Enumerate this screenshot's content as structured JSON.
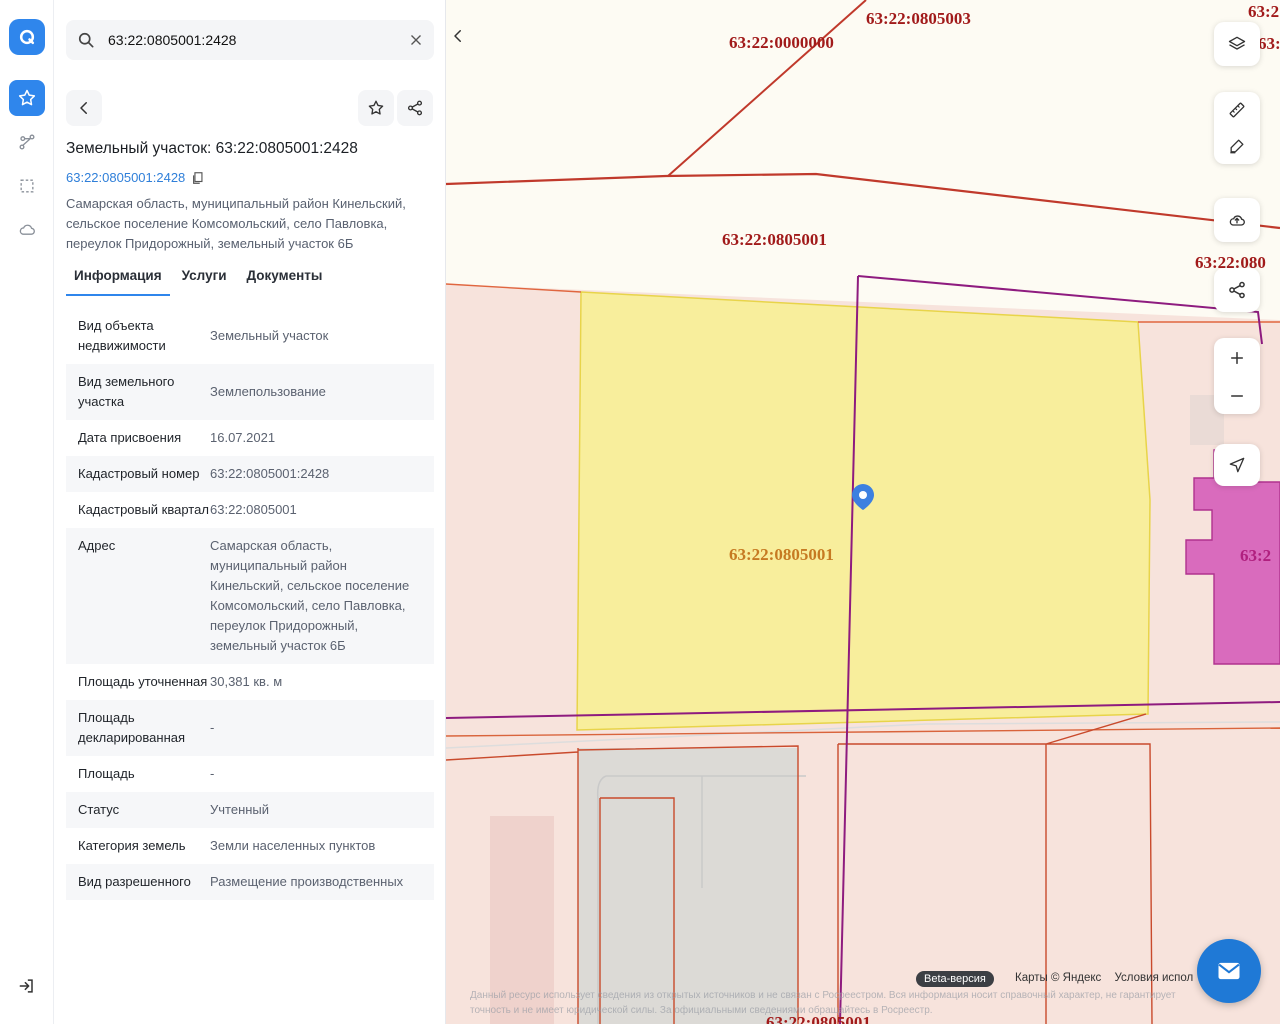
{
  "search": {
    "value": "63:22:0805001:2428"
  },
  "object": {
    "title": "Земельный участок: 63:22:0805001:2428",
    "cadastral_link": "63:22:0805001:2428",
    "address": "Самарская область, муниципальный район Кинельский, сельское поселение Комсомольский, село Павловка, переулок Придорожный, земельный участок 6Б"
  },
  "tabs": [
    {
      "label": "Информация",
      "active": true
    },
    {
      "label": "Услуги"
    },
    {
      "label": "Документы"
    }
  ],
  "properties": [
    {
      "key": "Вид объекта недвижимости",
      "value": "Земельный участок"
    },
    {
      "key": "Вид земельного участка",
      "value": "Землепользование"
    },
    {
      "key": "Дата присвоения",
      "value": "16.07.2021"
    },
    {
      "key": "Кадастровый номер",
      "value": "63:22:0805001:2428"
    },
    {
      "key": "Кадастровый квартал",
      "value": "63:22:0805001"
    },
    {
      "key": "Адрес",
      "value": "Самарская область, муниципальный район Кинельский, сельское поселение Комсомольский, село Павловка, переулок Придорожный, земельный участок 6Б"
    },
    {
      "key": "Площадь уточненная",
      "value": "30,381 кв. м"
    },
    {
      "key": "Площадь декларированная",
      "value": "-"
    },
    {
      "key": "Площадь",
      "value": "-"
    },
    {
      "key": "Статус",
      "value": "Учтенный"
    },
    {
      "key": "Категория земель",
      "value": "Земли населенных пунктов"
    },
    {
      "key": "Вид разрешенного",
      "value": "Размещение производственных"
    }
  ],
  "map": {
    "labels": {
      "q_0000000": "63:22:0000000",
      "q_0805003": "63:22:0805003",
      "q_0805001_top": "63:22:0805001",
      "q_0805001_parcel": "63:22:0805001",
      "q_right_top": "63:2",
      "q_right_top2": "63:2",
      "q_right_mid": "63:22:080",
      "q_right_pink": "63:2",
      "q_bottom": "63:22:0805001"
    },
    "beta": "Beta-версия",
    "attribution": [
      "Карты © Яндекс",
      "Условия испол"
    ],
    "disclaimer": "Данный ресурс использует сведения из открытых источников и не связан с Росреестром. Вся информация носит справочный характер, не гарантирует точность и не имеет юридической силы. За официальными сведениями обращайтесь в Росреестр."
  },
  "colors": {
    "accent": "#2f86ec",
    "parcel_fill": "#f8ee9c",
    "boundary_red": "#c0392b",
    "boundary_purple": "#8e1b7f",
    "pink_building": "#d96bbd"
  }
}
